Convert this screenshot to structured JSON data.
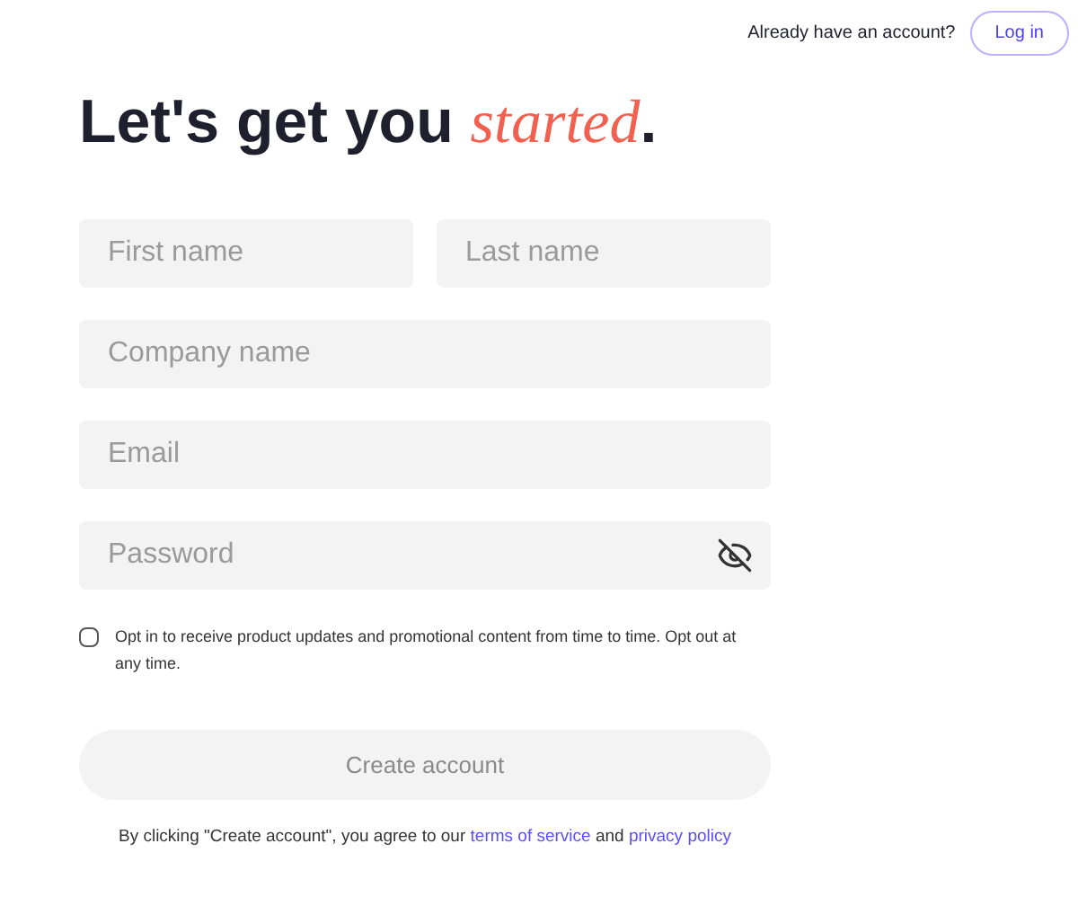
{
  "header": {
    "prompt": "Already have an account?",
    "login_button": "Log in"
  },
  "heading": {
    "lead": "Let's get you",
    "emphasis": "started",
    "trail": "."
  },
  "field_rows": [
    [
      {
        "placeholder": "First name",
        "kind": "text"
      },
      {
        "placeholder": "Last name",
        "kind": "text"
      }
    ],
    [
      {
        "placeholder": "Company name",
        "kind": "text"
      }
    ],
    [
      {
        "placeholder": "Email",
        "kind": "text"
      }
    ],
    [
      {
        "placeholder": "Password",
        "kind": "password"
      }
    ]
  ],
  "opt_in": {
    "checked": false,
    "label": "Opt in to receive product updates and promotional content from time to time. Opt out at any time."
  },
  "create_button": {
    "label": "Create account",
    "disabled": true
  },
  "legal": {
    "before": "By clicking \"Create account\", you agree to our",
    "link_1": "terms of service",
    "middle": "and",
    "link_2": "privacy policy"
  }
}
